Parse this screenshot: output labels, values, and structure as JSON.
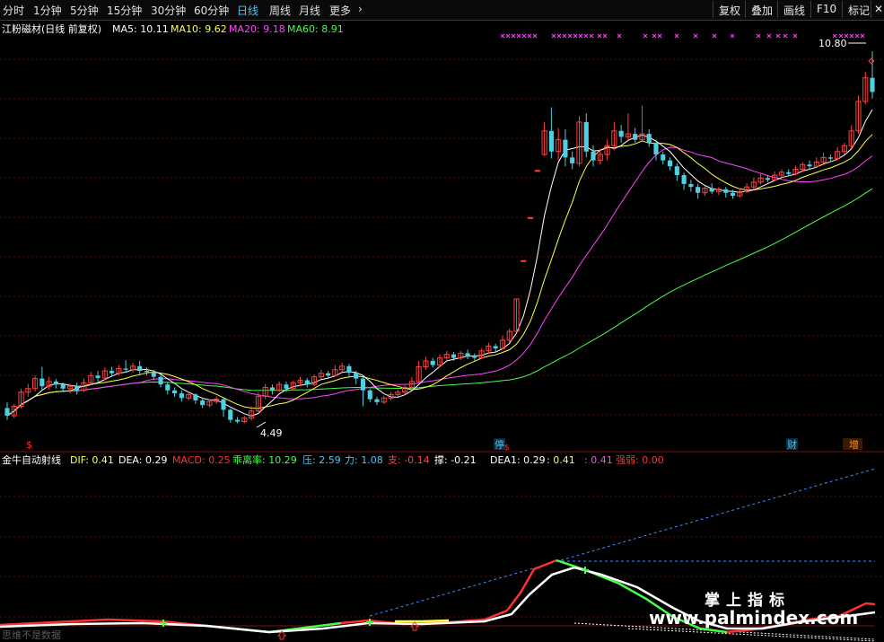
{
  "toolbar": {
    "timeframes": [
      {
        "label": "分时",
        "active": false
      },
      {
        "label": "1分钟",
        "active": false
      },
      {
        "label": "5分钟",
        "active": false
      },
      {
        "label": "15分钟",
        "active": false
      },
      {
        "label": "30分钟",
        "active": false
      },
      {
        "label": "60分钟",
        "active": false
      },
      {
        "label": "日线",
        "active": true
      },
      {
        "label": "周线",
        "active": false
      },
      {
        "label": "月线",
        "active": false
      },
      {
        "label": "更多",
        "active": false
      }
    ],
    "more_arrow": "›",
    "right_buttons": [
      "复权",
      "叠加",
      "画线",
      "F10",
      "标记"
    ],
    "close_label": "✕"
  },
  "main_legend": {
    "title": "江粉磁材(日线 前复权)",
    "items": [
      {
        "label": "MA5",
        "value": "10.11",
        "color": "#ffffff"
      },
      {
        "label": "MA10",
        "value": "9.62",
        "color": "#ffff44"
      },
      {
        "label": "MA20",
        "value": "9.18",
        "color": "#ff44ff"
      },
      {
        "label": "MA60",
        "value": "8.91",
        "color": "#44ff44"
      }
    ]
  },
  "price_labels": {
    "high": "10.80",
    "low": "4.49"
  },
  "event_markers": [
    {
      "text": "$",
      "color": "#ff3030"
    },
    {
      "text": "停",
      "color": "#4fc3f7"
    },
    {
      "text": "$",
      "color": "#ff3030"
    },
    {
      "text": "财",
      "color": "#4fc3f7"
    },
    {
      "text": "增",
      "color": "#ff8c1a"
    }
  ],
  "sub_legend": {
    "title": "金牛自动射线",
    "items": [
      {
        "label": "DIF",
        "value": "0.41",
        "color": "#ffff44"
      },
      {
        "label": "DEA",
        "value": "0.29",
        "color": "#ffffff"
      },
      {
        "label": "MACD",
        "value": "0.25",
        "color": "#ff3030"
      },
      {
        "label": "乖离率",
        "value": "10.29",
        "color": "#44ff44"
      },
      {
        "label": "压",
        "value": "2.59",
        "color": "#4fc3f7"
      },
      {
        "label": "力",
        "value": "1.08",
        "color": "#4fc3f7"
      },
      {
        "label": "支",
        "value": "-0.14",
        "color": "#ff4444"
      },
      {
        "label": "撑",
        "value": "-0.21",
        "color": "#ffffff"
      },
      {
        "label": "DEA1",
        "value": "0.29",
        "color": "#ffffff"
      },
      {
        "label": "",
        "value": "0.41",
        "color": "#ffff44"
      },
      {
        "label": "",
        "value": "0.41",
        "color": "#ff44ff"
      },
      {
        "label": "强弱",
        "value": "0.00",
        "color": "#ff3030"
      }
    ]
  },
  "watermark": {
    "cn": "掌上指标",
    "url": "www.palmindex.com"
  },
  "note": "思维不是数据",
  "colors": {
    "up": "#ff4040",
    "down": "#4fd0e0",
    "ma5": "#ffffff",
    "ma10": "#ffff44",
    "ma20": "#ff44ff",
    "ma60": "#44ff44",
    "grid": "#5a0a0a",
    "ray": "#3a8fff"
  },
  "chart_data": {
    "type": "candlestick",
    "symbol": "江粉磁材",
    "period": "日线 前复权",
    "candles": [
      [
        4.75,
        4.62,
        4.85,
        4.55
      ],
      [
        4.62,
        4.78,
        4.82,
        4.58
      ],
      [
        4.78,
        5.02,
        5.08,
        4.74
      ],
      [
        5.02,
        5.08,
        5.16,
        4.94
      ],
      [
        5.08,
        5.25,
        5.3,
        5.03
      ],
      [
        5.25,
        5.12,
        5.45,
        5.05
      ],
      [
        5.12,
        5.2,
        5.28,
        5.06
      ],
      [
        5.2,
        5.15,
        5.24,
        5.08
      ],
      [
        5.15,
        5.08,
        5.18,
        5.02
      ],
      [
        5.08,
        5.12,
        5.16,
        5.0
      ],
      [
        5.12,
        5.05,
        5.18,
        4.98
      ],
      [
        5.05,
        5.18,
        5.25,
        5.02
      ],
      [
        5.18,
        5.3,
        5.36,
        5.14
      ],
      [
        5.3,
        5.26,
        5.38,
        5.2
      ],
      [
        5.26,
        5.38,
        5.44,
        5.22
      ],
      [
        5.38,
        5.34,
        5.45,
        5.28
      ],
      [
        5.34,
        5.42,
        5.48,
        5.3
      ],
      [
        5.42,
        5.4,
        5.56,
        5.35
      ],
      [
        5.4,
        5.46,
        5.52,
        5.36
      ],
      [
        5.46,
        5.38,
        5.55,
        5.32
      ],
      [
        5.38,
        5.36,
        5.44,
        5.3
      ],
      [
        5.36,
        5.28,
        5.4,
        5.22
      ],
      [
        5.28,
        5.15,
        5.32,
        5.1
      ],
      [
        5.15,
        5.05,
        5.2,
        4.98
      ],
      [
        5.05,
        5.0,
        5.1,
        4.94
      ],
      [
        5.0,
        4.92,
        5.05,
        4.86
      ],
      [
        4.92,
        4.98,
        5.02,
        4.88
      ],
      [
        4.98,
        4.88,
        5.0,
        4.82
      ],
      [
        4.88,
        4.8,
        4.92,
        4.75
      ],
      [
        4.8,
        4.86,
        4.9,
        4.76
      ],
      [
        4.86,
        4.9,
        4.95,
        4.82
      ],
      [
        4.9,
        4.72,
        4.92,
        4.6
      ],
      [
        4.72,
        4.55,
        4.74,
        4.5
      ],
      [
        4.55,
        4.52,
        4.6,
        4.49
      ],
      [
        4.52,
        4.58,
        4.62,
        4.49
      ],
      [
        4.58,
        4.7,
        4.78,
        4.54
      ],
      [
        4.7,
        4.95,
        5.02,
        4.68
      ],
      [
        4.95,
        5.1,
        5.16,
        4.9
      ],
      [
        5.1,
        5.05,
        5.15,
        4.98
      ],
      [
        5.05,
        5.15,
        5.2,
        5.02
      ],
      [
        5.15,
        5.08,
        5.2,
        5.02
      ],
      [
        5.08,
        5.18,
        5.22,
        5.04
      ],
      [
        5.18,
        5.22,
        5.28,
        5.12
      ],
      [
        5.22,
        5.15,
        5.26,
        5.1
      ],
      [
        5.15,
        5.28,
        5.32,
        5.12
      ],
      [
        5.28,
        5.34,
        5.4,
        5.24
      ],
      [
        5.34,
        5.3,
        5.38,
        5.26
      ],
      [
        5.3,
        5.4,
        5.48,
        5.28
      ],
      [
        5.4,
        5.46,
        5.52,
        5.36
      ],
      [
        5.46,
        5.35,
        5.5,
        5.28
      ],
      [
        5.35,
        5.25,
        5.38,
        5.15
      ],
      [
        5.25,
        5.05,
        5.28,
        4.78
      ],
      [
        5.05,
        4.9,
        5.08,
        4.85
      ],
      [
        4.9,
        4.85,
        4.94,
        4.8
      ],
      [
        4.85,
        4.92,
        4.96,
        4.82
      ],
      [
        4.92,
        4.98,
        5.02,
        4.88
      ],
      [
        4.98,
        5.02,
        5.06,
        4.94
      ],
      [
        5.02,
        5.1,
        5.14,
        4.98
      ],
      [
        5.1,
        5.2,
        5.28,
        5.06
      ],
      [
        5.2,
        5.45,
        5.55,
        5.18
      ],
      [
        5.45,
        5.55,
        5.62,
        5.4
      ],
      [
        5.55,
        5.48,
        5.6,
        5.44
      ],
      [
        5.48,
        5.6,
        5.66,
        5.45
      ],
      [
        5.6,
        5.66,
        5.72,
        5.56
      ],
      [
        5.66,
        5.6,
        5.7,
        5.55
      ],
      [
        5.6,
        5.68,
        5.72,
        5.56
      ],
      [
        5.68,
        5.62,
        5.74,
        5.58
      ],
      [
        5.62,
        5.6,
        5.68,
        5.55
      ],
      [
        5.6,
        5.72,
        5.76,
        5.58
      ],
      [
        5.72,
        5.8,
        5.86,
        5.68
      ],
      [
        5.8,
        5.76,
        5.84,
        5.7
      ],
      [
        5.76,
        5.9,
        5.98,
        5.74
      ],
      [
        5.9,
        6.05,
        6.1,
        5.86
      ],
      [
        6.05,
        6.6,
        6.6,
        6.05
      ],
      [
        7.25,
        7.25,
        7.25,
        7.25
      ],
      [
        7.98,
        7.98,
        7.98,
        7.98
      ],
      [
        8.78,
        8.78,
        8.78,
        8.78
      ],
      [
        9.05,
        9.45,
        9.6,
        9.02
      ],
      [
        9.45,
        9.1,
        9.85,
        8.98
      ],
      [
        9.1,
        9.3,
        9.5,
        8.95
      ],
      [
        9.3,
        9.0,
        9.48,
        8.85
      ],
      [
        9.0,
        8.9,
        9.1,
        8.8
      ],
      [
        8.9,
        9.6,
        9.7,
        8.85
      ],
      [
        9.6,
        9.1,
        9.75,
        9.0
      ],
      [
        9.1,
        8.95,
        9.2,
        8.85
      ],
      [
        8.95,
        9.05,
        9.15,
        8.88
      ],
      [
        9.05,
        9.2,
        9.3,
        8.95
      ],
      [
        9.2,
        9.45,
        9.6,
        9.12
      ],
      [
        9.45,
        9.35,
        9.55,
        9.25
      ],
      [
        9.35,
        9.4,
        9.75,
        9.3
      ],
      [
        9.4,
        9.3,
        9.5,
        9.25
      ],
      [
        9.3,
        9.4,
        9.88,
        9.28
      ],
      [
        9.4,
        9.25,
        9.48,
        9.18
      ],
      [
        9.25,
        9.05,
        9.3,
        8.95
      ],
      [
        9.05,
        8.95,
        9.1,
        8.88
      ],
      [
        8.95,
        8.85,
        9.0,
        8.78
      ],
      [
        8.85,
        8.7,
        8.9,
        8.6
      ],
      [
        8.7,
        8.55,
        8.74,
        8.45
      ],
      [
        8.55,
        8.5,
        8.62,
        8.42
      ],
      [
        8.5,
        8.4,
        8.55,
        8.3
      ],
      [
        8.4,
        8.48,
        8.52,
        8.35
      ],
      [
        8.48,
        8.42,
        8.56,
        8.38
      ],
      [
        8.42,
        8.46,
        8.5,
        8.36
      ],
      [
        8.46,
        8.4,
        8.5,
        8.32
      ],
      [
        8.4,
        8.35,
        8.45,
        8.3
      ],
      [
        8.35,
        8.42,
        8.48,
        8.32
      ],
      [
        8.42,
        8.5,
        8.56,
        8.4
      ],
      [
        8.5,
        8.58,
        8.66,
        8.46
      ],
      [
        8.58,
        8.65,
        8.72,
        8.54
      ],
      [
        8.65,
        8.62,
        8.7,
        8.58
      ],
      [
        8.62,
        8.7,
        8.76,
        8.6
      ],
      [
        8.7,
        8.75,
        8.8,
        8.66
      ],
      [
        8.75,
        8.72,
        8.8,
        8.68
      ],
      [
        8.72,
        8.8,
        8.86,
        8.7
      ],
      [
        8.8,
        8.88,
        8.92,
        8.76
      ],
      [
        8.88,
        8.85,
        8.95,
        8.8
      ],
      [
        8.85,
        8.92,
        9.0,
        8.82
      ],
      [
        8.92,
        9.0,
        9.08,
        8.9
      ],
      [
        9.0,
        8.98,
        9.05,
        8.92
      ],
      [
        8.98,
        9.1,
        9.18,
        8.95
      ],
      [
        9.1,
        9.2,
        9.25,
        9.05
      ],
      [
        9.2,
        9.45,
        9.55,
        9.15
      ],
      [
        9.45,
        9.95,
        10.05,
        9.4
      ],
      [
        9.95,
        10.35,
        10.45,
        9.9
      ],
      [
        10.35,
        10.11,
        10.8,
        10.0
      ]
    ],
    "indicators": [
      "MA5",
      "MA10",
      "MA20",
      "MA60"
    ]
  }
}
